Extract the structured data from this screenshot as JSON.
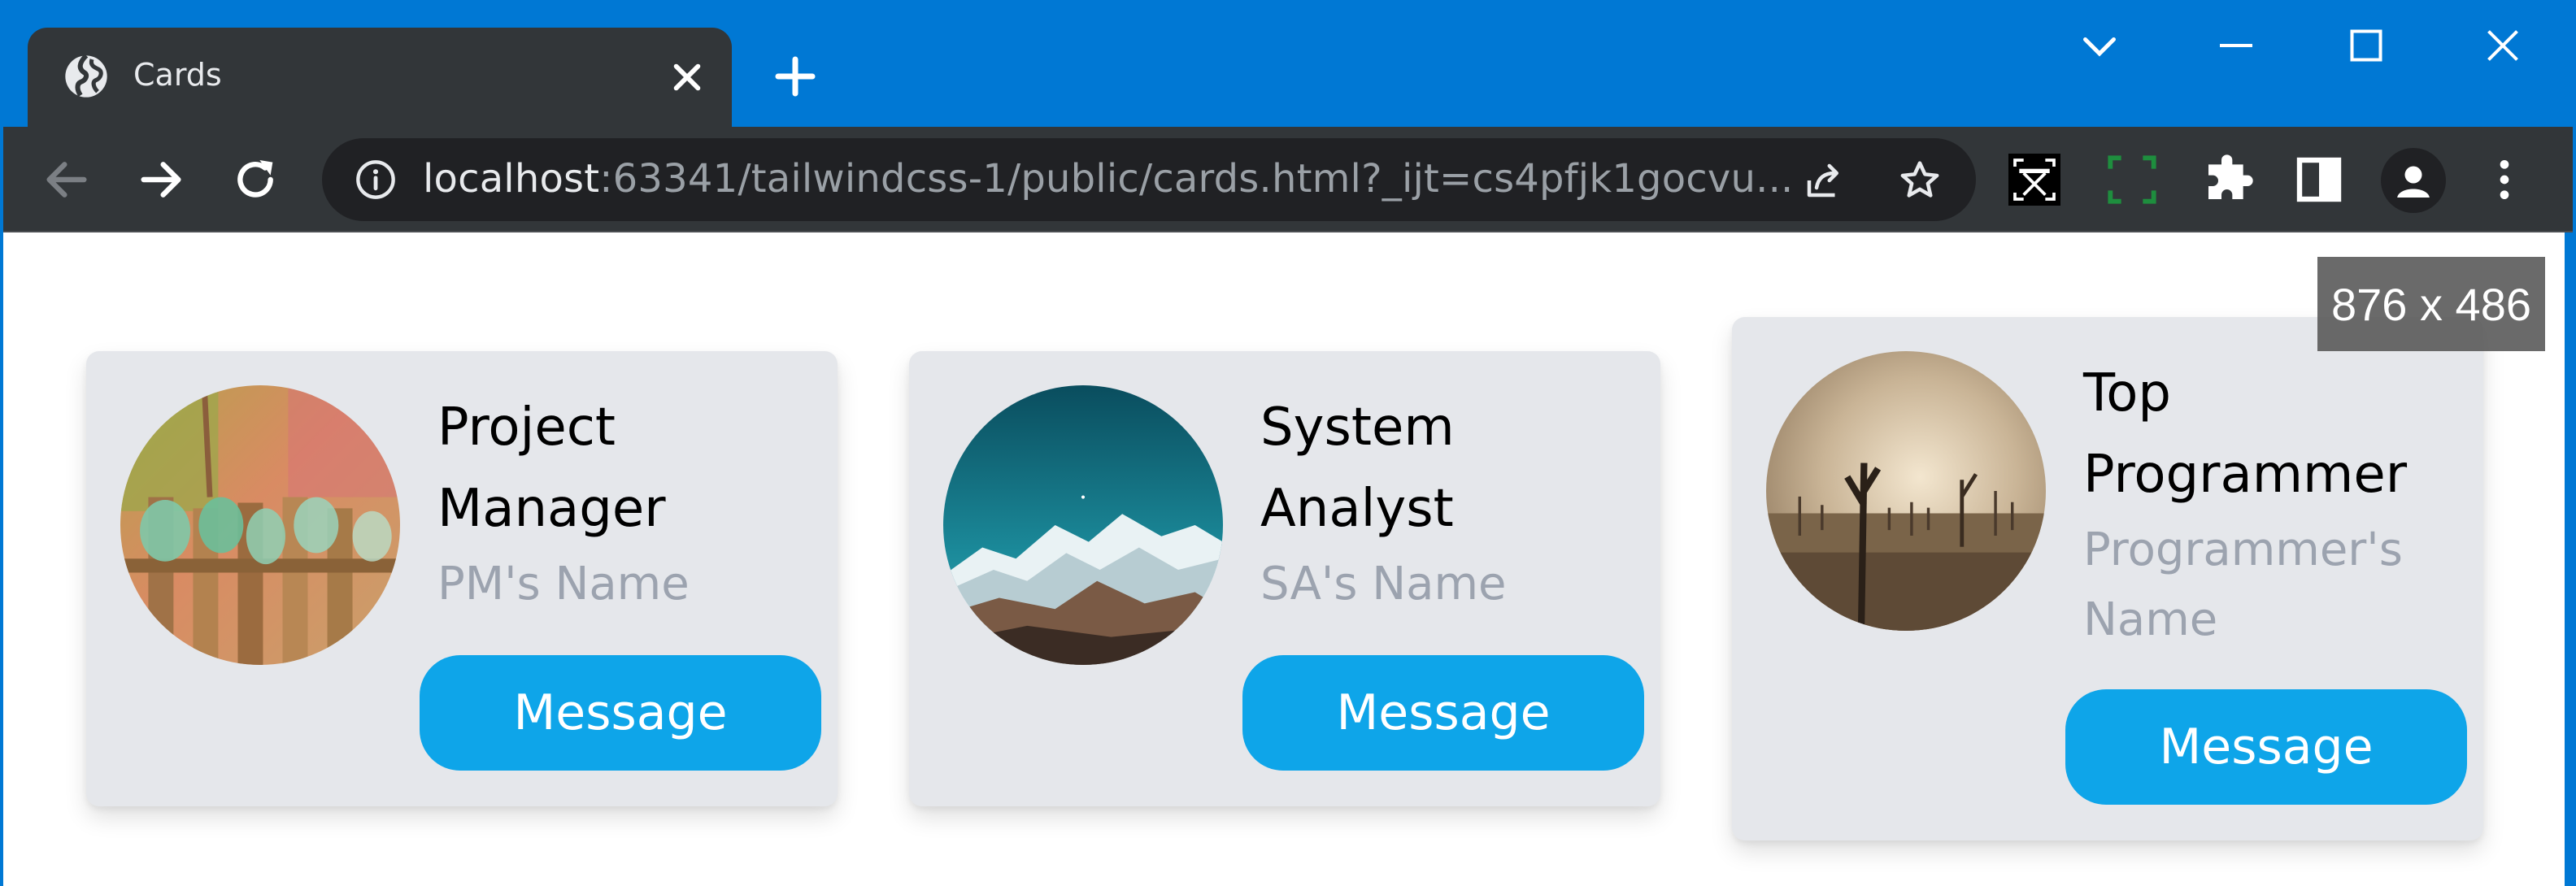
{
  "browser": {
    "tab_title": "Cards",
    "url_host": "localhost",
    "url_rest": ":63341/tailwindcss-1/public/cards.html?_ijt=cs4pfjk1gocvu..."
  },
  "overlay": {
    "size_readout": "876 x 486"
  },
  "cards": [
    {
      "role": "Project Manager",
      "name": "PM's Name",
      "button_label": "Message",
      "photo": "glass-bottles-on-fence"
    },
    {
      "role": "System Analyst",
      "name": "SA's Name",
      "button_label": "Message",
      "photo": "snowy-mountain-teal-sky"
    },
    {
      "role": "Top Programmer",
      "name": "Programmer's Name",
      "button_label": "Message",
      "photo": "misty-dead-trees"
    }
  ],
  "colors": {
    "titlebar": "#0078d4",
    "toolbar": "#323639",
    "card_bg": "#e5e7eb",
    "button": "#0ea5e9",
    "name_text": "#9ca3af"
  },
  "icons": {
    "tab": "globe-icon",
    "tab_close": "close-icon",
    "new_tab": "plus-icon",
    "back": "arrow-left-icon",
    "forward": "arrow-right-icon",
    "reload": "reload-icon",
    "site_info": "info-icon",
    "share": "share-icon",
    "bookmark": "star-icon",
    "extensions": "puzzle-icon",
    "side_panel": "side-panel-icon",
    "profile": "profile-icon",
    "menu": "kebab-menu-icon"
  }
}
